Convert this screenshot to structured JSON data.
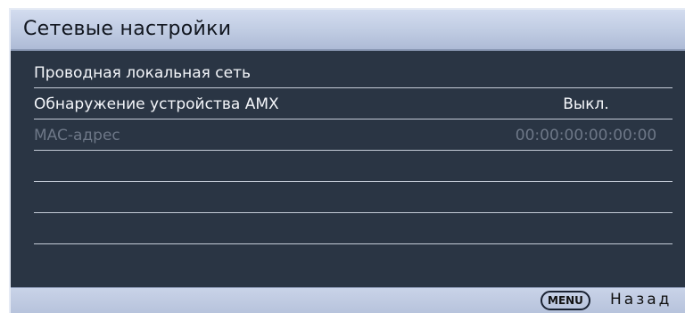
{
  "header": {
    "title": "Сетевые настройки"
  },
  "rows": [
    {
      "label": "Проводная локальная сеть",
      "value": ""
    },
    {
      "label": "Обнаружение устройства AMX",
      "value": "Выкл."
    },
    {
      "label": "MAC-адрес",
      "value": "00:00:00:00:00:00"
    }
  ],
  "footer": {
    "menu_key": "MENU",
    "back_label": "Назад"
  },
  "colors": {
    "panel_bg": "#2a3544",
    "header_bg": "#c3cee5",
    "text": "#f4f6fa",
    "disabled_text": "#6d7787"
  }
}
